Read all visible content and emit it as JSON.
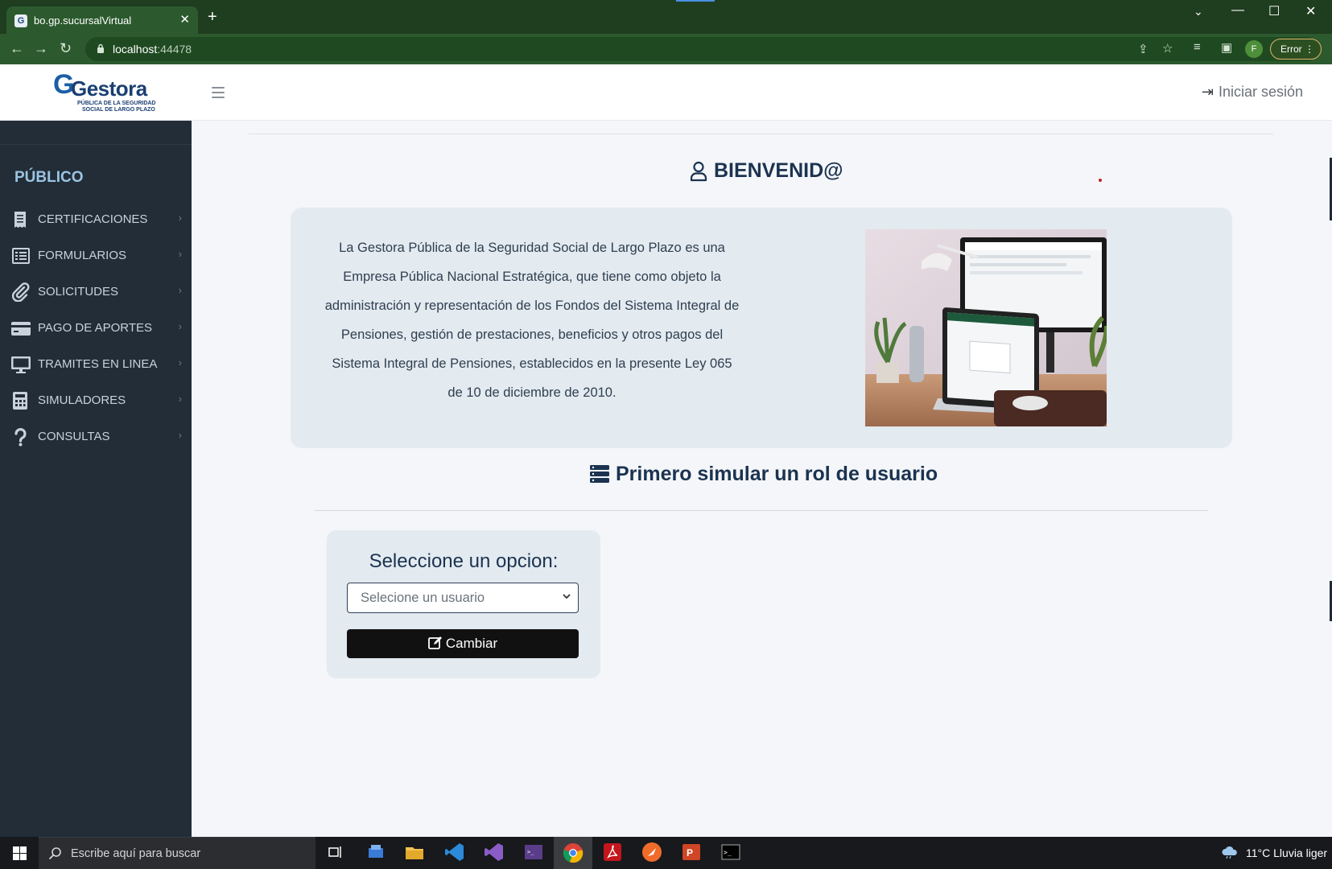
{
  "browser": {
    "tab_title": "bo.gp.sucursalVirtual",
    "favicon_letter": "G",
    "url_host": "localhost",
    "url_port": ":44478",
    "profile_initial": "F",
    "error_label": "Error"
  },
  "header": {
    "logo_word": "Gestora",
    "logo_sub1": "PÚBLICA DE LA SEGURIDAD",
    "logo_sub2": "SOCIAL DE LARGO PLAZO",
    "login_label": "Iniciar sesión"
  },
  "sidebar": {
    "section_title": "PÚBLICO",
    "items": [
      {
        "label": "CERTIFICACIONES",
        "icon": "receipt-icon"
      },
      {
        "label": "FORMULARIOS",
        "icon": "form-list-icon"
      },
      {
        "label": "SOLICITUDES",
        "icon": "paperclip-icon"
      },
      {
        "label": "PAGO DE APORTES",
        "icon": "credit-card-icon"
      },
      {
        "label": "TRAMITES EN LINEA",
        "icon": "monitor-icon"
      },
      {
        "label": "SIMULADORES",
        "icon": "calculator-icon"
      },
      {
        "label": "CONSULTAS",
        "icon": "question-icon"
      }
    ]
  },
  "main": {
    "welcome_title": "BIENVENID@",
    "info_text": "La Gestora Pública de la Seguridad Social de Largo Plazo es una Empresa Pública Nacional Estratégica, que tiene como objeto la administración y representación de los Fondos del Sistema Integral de Pensiones, gestión de prestaciones, beneficios y otros pagos del Sistema Integral de Pensiones, establecidos en la presente Ley 065 de 10 de diciembre de 2010.",
    "simulate_title": "Primero simular un rol de usuario",
    "option_heading": "Seleccione un opcion:",
    "select_value": "Selecione un usuario",
    "change_button": "Cambiar"
  },
  "taskbar": {
    "search_placeholder": "Escribe aquí para buscar",
    "weather": "11°C  Lluvia liger"
  },
  "colors": {
    "browser_frame": "#2c5a2e",
    "sidebar_bg": "#222d38",
    "section_title": "#9bc4e2",
    "heading": "#1b3350",
    "card_bg": "#e3eaf0",
    "button_bg": "#111111"
  }
}
